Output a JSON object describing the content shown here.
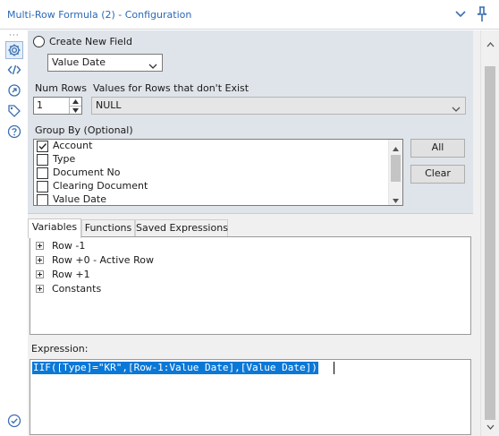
{
  "window": {
    "title": "Multi-Row Formula (2) - Configuration"
  },
  "sidebar": {
    "icons": [
      "gear-icon",
      "code-icon",
      "link-icon",
      "tag-icon",
      "help-icon"
    ],
    "footer_icon": "check-circle-icon"
  },
  "config": {
    "create_new_label": "Create New  Field",
    "create_new_field_value": "Value Date",
    "num_rows_label": "Num Rows",
    "num_rows_value": "1",
    "nonexist_label": "Values for Rows that don't Exist",
    "nonexist_value": "NULL",
    "group_by_label": "Group By (Optional)",
    "group_by_items": [
      {
        "label": "Account",
        "checked": true
      },
      {
        "label": "Type",
        "checked": false
      },
      {
        "label": "Document No",
        "checked": false
      },
      {
        "label": "Clearing Document",
        "checked": false
      },
      {
        "label": "Value Date",
        "checked": false
      }
    ],
    "all_button": "All",
    "clear_button": "Clear"
  },
  "tabs": [
    {
      "label": "Variables",
      "active": true
    },
    {
      "label": "Functions",
      "active": false
    },
    {
      "label": "Saved Expressions",
      "active": false
    }
  ],
  "variables_tree": [
    "Row -1",
    "Row +0 - Active Row",
    "Row +1",
    "Constants"
  ],
  "expression": {
    "label": "Expression:",
    "text": "IIF([Type]=\"KR\",[Row-1:Value Date],[Value Date])"
  },
  "colors": {
    "title_text": "#2a6ab8",
    "selection": "#0a78d7",
    "config_panel": "#dfe4ea",
    "accent_icon": "#3c6fb0"
  }
}
